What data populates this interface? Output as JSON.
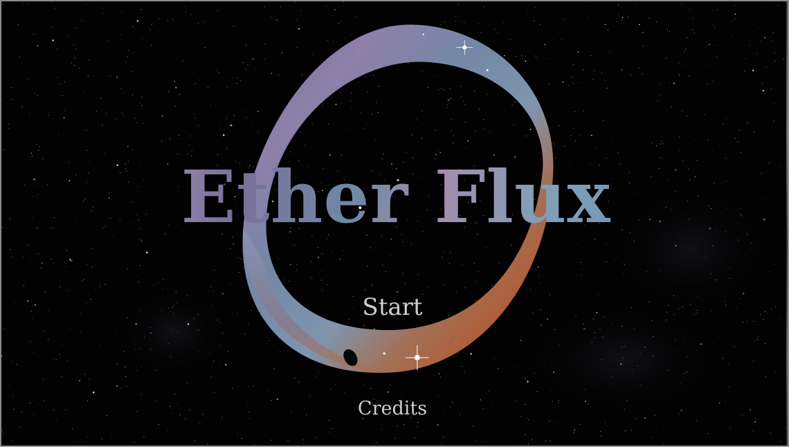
{
  "game": {
    "title": "Ether Flux"
  },
  "menu": {
    "start_label": "Start",
    "credits_label": "Credits"
  },
  "colors": {
    "background": "#020203",
    "menu_text": "#cfcfcf",
    "nebula_blue": "#8ea6bf",
    "nebula_violet": "#7a6f98",
    "nebula_orange": "#c0643a"
  }
}
